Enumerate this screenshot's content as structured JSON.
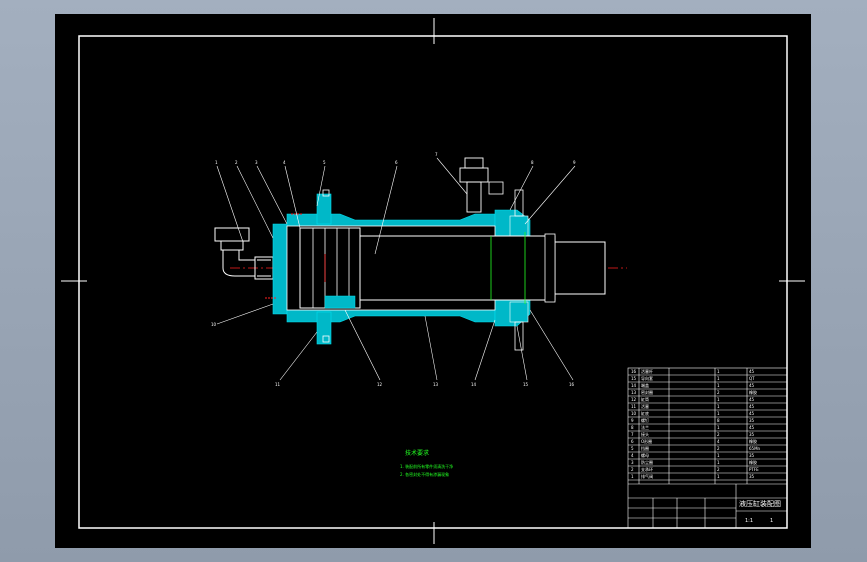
{
  "drawing": {
    "colors": {
      "background": "#000000",
      "frame": "#ffffff",
      "section": "#00b8c8",
      "outline": "#ffffff",
      "centerline": "#ff2020",
      "note": "#22ff22",
      "viewport": "#9aa6b6"
    },
    "notes": {
      "title": "技术要求",
      "line1": "1. 装配前所有零件须清洗干净",
      "line2": "2. 各密封处不得有渗漏现象"
    },
    "part_numbers": [
      "1",
      "2",
      "3",
      "4",
      "5",
      "6",
      "7",
      "8",
      "9",
      "10",
      "11",
      "12",
      "13",
      "14",
      "15",
      "16"
    ],
    "title_block": {
      "drawing_name": "液压缸装配图",
      "scale": "1:1",
      "sheet": "1",
      "rows": [
        {
          "no": "16",
          "name": "活塞杆",
          "qty": "1",
          "mat": "45"
        },
        {
          "no": "15",
          "name": "导向套",
          "qty": "1",
          "mat": "QT"
        },
        {
          "no": "14",
          "name": "端盖",
          "qty": "1",
          "mat": "45"
        },
        {
          "no": "13",
          "name": "密封圈",
          "qty": "2",
          "mat": "橡胶"
        },
        {
          "no": "12",
          "name": "缸筒",
          "qty": "1",
          "mat": "45"
        },
        {
          "no": "11",
          "name": "活塞",
          "qty": "1",
          "mat": "45"
        },
        {
          "no": "10",
          "name": "缸底",
          "qty": "1",
          "mat": "45"
        },
        {
          "no": "9",
          "name": "螺钉",
          "qty": "8",
          "mat": "35"
        },
        {
          "no": "8",
          "name": "法兰",
          "qty": "1",
          "mat": "45"
        },
        {
          "no": "7",
          "name": "接头",
          "qty": "2",
          "mat": "35"
        },
        {
          "no": "6",
          "name": "O形圈",
          "qty": "4",
          "mat": "橡胶"
        },
        {
          "no": "5",
          "name": "挡圈",
          "qty": "2",
          "mat": "65Mn"
        },
        {
          "no": "4",
          "name": "螺母",
          "qty": "1",
          "mat": "35"
        },
        {
          "no": "3",
          "name": "防尘圈",
          "qty": "1",
          "mat": "橡胶"
        },
        {
          "no": "2",
          "name": "支承环",
          "qty": "2",
          "mat": "PTFE"
        },
        {
          "no": "1",
          "name": "排气阀",
          "qty": "1",
          "mat": "35"
        }
      ]
    }
  }
}
